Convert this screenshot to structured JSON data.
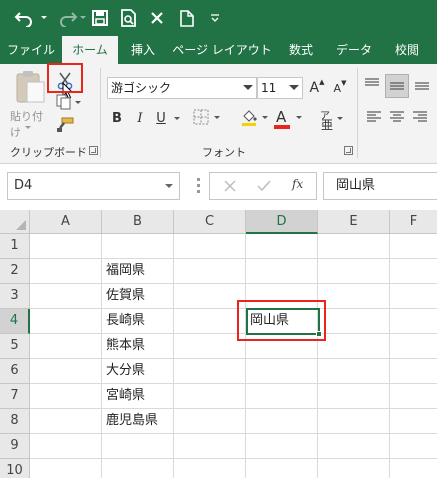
{
  "quick_access": {
    "undo_icon": "undo-icon",
    "redo_icon": "redo-icon",
    "save_icon": "save-icon",
    "print_preview_icon": "print-preview-icon",
    "close_icon": "close-icon",
    "new_icon": "new-document-icon",
    "customize_icon": "customize-qat-icon"
  },
  "tabs": [
    "ファイル",
    "ホーム",
    "挿入",
    "ページ レイアウト",
    "数式",
    "データ",
    "校閲"
  ],
  "active_tab": "ホーム",
  "ribbon": {
    "clipboard": {
      "paste_label": "貼り付け",
      "group_label": "クリップボード"
    },
    "font": {
      "font_name": "游ゴシック",
      "font_size": "11",
      "grow_label": "A",
      "shrink_label": "A",
      "bold": "B",
      "italic": "I",
      "underline": "U",
      "font_color_label": "A",
      "phonetic_label": "ア",
      "group_label": "フォント",
      "font_color": "#e8261c"
    }
  },
  "formula_bar": {
    "name_box": "D4",
    "fx_label": "fx",
    "content": "岡山県"
  },
  "grid": {
    "columns": [
      "A",
      "B",
      "C",
      "D",
      "E",
      "F"
    ],
    "rows": [
      "1",
      "2",
      "3",
      "4",
      "5",
      "6",
      "7",
      "8",
      "9",
      "10"
    ],
    "selected_column": "D",
    "selected_row": "4",
    "cells": {
      "B2": "福岡県",
      "B3": "佐賀県",
      "B4": "長崎県",
      "B5": "熊本県",
      "B6": "大分県",
      "B7": "宮崎県",
      "B8": "鹿児島県",
      "D4": "岡山県"
    }
  },
  "colors": {
    "accent": "#217346",
    "highlight": "#e8261c"
  }
}
